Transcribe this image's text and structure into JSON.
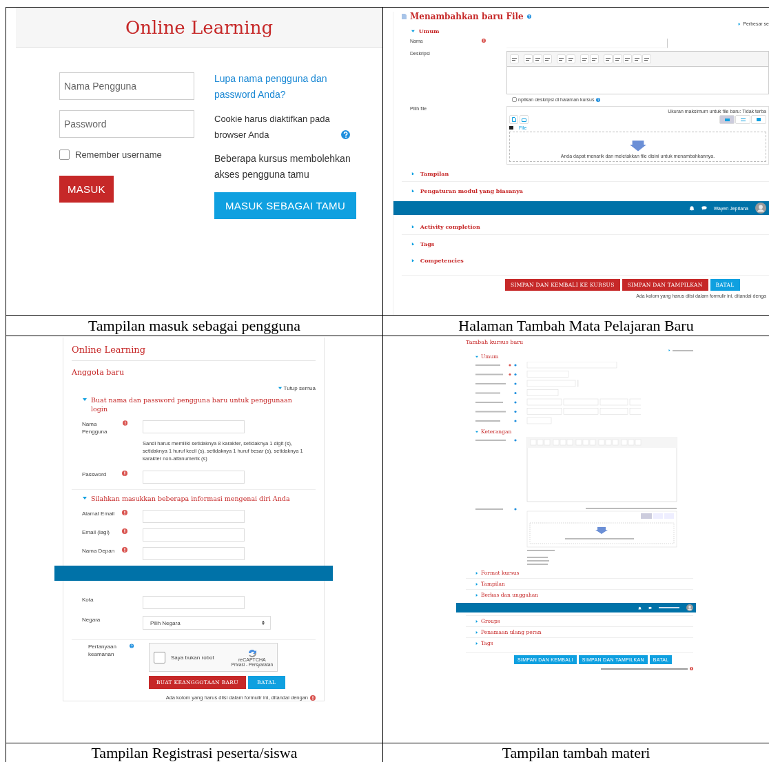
{
  "login": {
    "title": "Online Learning",
    "username": {
      "placeholder": "Nama Pengguna"
    },
    "password": {
      "placeholder": "Password"
    },
    "remember": {
      "label": "Remember username",
      "checked": false
    },
    "submit": "MASUK",
    "forgot_link": "Lupa nama pengguna dan password Anda?",
    "cookie_note": "Cookie harus diaktifkan pada browser Anda",
    "guest_note": "Beberapa kursus membolehkan akses pengguna tamu",
    "guest_button": "MASUK SEBAGAI TAMU"
  },
  "add_file": {
    "title": "Menambahkan baru File",
    "expand_link": "Perbesar se",
    "general": {
      "label": "Umum",
      "expanded": true
    },
    "name_label": "Nama",
    "description_label": "Deskripsi",
    "show_description": {
      "label": "npilkan deskripsi di halaman kursus",
      "checked": false
    },
    "file_label": "Pilih file",
    "max_size": "Ukuran maksimum untuk file baru: Tidak terba",
    "folder": "File",
    "drop_hint": "Anda dapat menarik dan meletakkan file disini untuk menambahkannya.",
    "sections_before_bar": [
      {
        "label": "Tampilan",
        "expanded": false
      },
      {
        "label": "Pengaturan modul yang biasanya",
        "expanded": false
      }
    ],
    "user": "Wayen Jepriana",
    "sections_after_bar": [
      {
        "label": "Activity completion",
        "expanded": false
      },
      {
        "label": "Tags",
        "expanded": false
      },
      {
        "label": "Competencies",
        "expanded": false
      }
    ],
    "buttons": [
      {
        "label": "SIMPAN DAN KEMBALI KE KURSUS",
        "kind": "primary"
      },
      {
        "label": "SIMPAN DAN TAMPILKAN",
        "kind": "primary"
      },
      {
        "label": "BATAL",
        "kind": "cancel"
      }
    ],
    "required_note": "Ada kolom yang harus diisi dalam formulir ini, ditandai denga"
  },
  "registration": {
    "site_title": "Online Learning",
    "heading": "Anggota baru",
    "collapse_all": "Tutup semua",
    "sections": [
      {
        "label": "Buat nama dan password pengguna baru untuk penggunaan login",
        "expanded": true,
        "fields": [
          {
            "label": "Nama Pengguna",
            "required": true,
            "kind": "text",
            "hint": "Sandi harus memiliki setidaknya 8 karakter, setidaknya 1 digit (s), setidaknya 1 huruf kecil (s), setidaknya 1 huruf besar (s), setidaknya 1 karakter non-alfanumerik (s)"
          },
          {
            "label": "Password",
            "required": true,
            "kind": "text"
          }
        ]
      },
      {
        "label": "Silahkan masukkan beberapa informasi mengenai diri Anda",
        "expanded": true,
        "fields": [
          {
            "label": "Alamat Email",
            "required": true,
            "kind": "text"
          },
          {
            "label": "Email (lagi)",
            "required": true,
            "kind": "text"
          },
          {
            "label": "Nama Depan",
            "required": true,
            "kind": "text"
          },
          {
            "kind": "bar"
          },
          {
            "label": "Kota",
            "required": false,
            "kind": "text"
          },
          {
            "label": "Negara",
            "required": false,
            "kind": "select",
            "value": "Pilih Negara"
          }
        ]
      }
    ],
    "security": {
      "label": "Pertanyaan keamanan",
      "captcha": "Saya bukan robot",
      "checked": false,
      "brand": "reCAPTCHA",
      "links": "Privasi - Persyaratan"
    },
    "buttons": [
      {
        "label": "BUAT KEANGGOTAAN BARU",
        "kind": "primary"
      },
      {
        "label": "BATAL",
        "kind": "cancel"
      }
    ],
    "required_note": "Ada kolom yang harus diisi dalam formulir ini, ditandai dengan"
  },
  "add_course": {
    "title": "Tambah kursus baru",
    "sections": [
      {
        "label": "Umum",
        "expanded": true,
        "kind": "general"
      },
      {
        "label": "Keterangan",
        "expanded": true,
        "kind": "description"
      },
      {
        "label": "Format kursus",
        "expanded": false,
        "kind": "plain"
      },
      {
        "label": "Tampilan",
        "expanded": false,
        "kind": "plain"
      },
      {
        "label": "Berkas dan unggahan",
        "expanded": false,
        "kind": "plain"
      },
      {
        "kind": "bar"
      },
      {
        "label": "Groups",
        "expanded": false,
        "kind": "plain"
      },
      {
        "label": "Penamaan ulang peran",
        "expanded": false,
        "kind": "plain"
      },
      {
        "label": "Tags",
        "expanded": false,
        "kind": "plain"
      }
    ],
    "buttons": [
      {
        "label": "SIMPAN DAN KEMBALI",
        "kind": "primary"
      },
      {
        "label": "SIMPAN DAN TAMPILKAN",
        "kind": "primary"
      },
      {
        "label": "BATAL",
        "kind": "primary"
      }
    ]
  },
  "captions": [
    "Tampilan masuk sebagai pengguna",
    "Halaman Tambah Mata Pelajaran Baru",
    "Tampilan Registrasi peserta/siswa",
    "Tampilan tambah materi"
  ]
}
